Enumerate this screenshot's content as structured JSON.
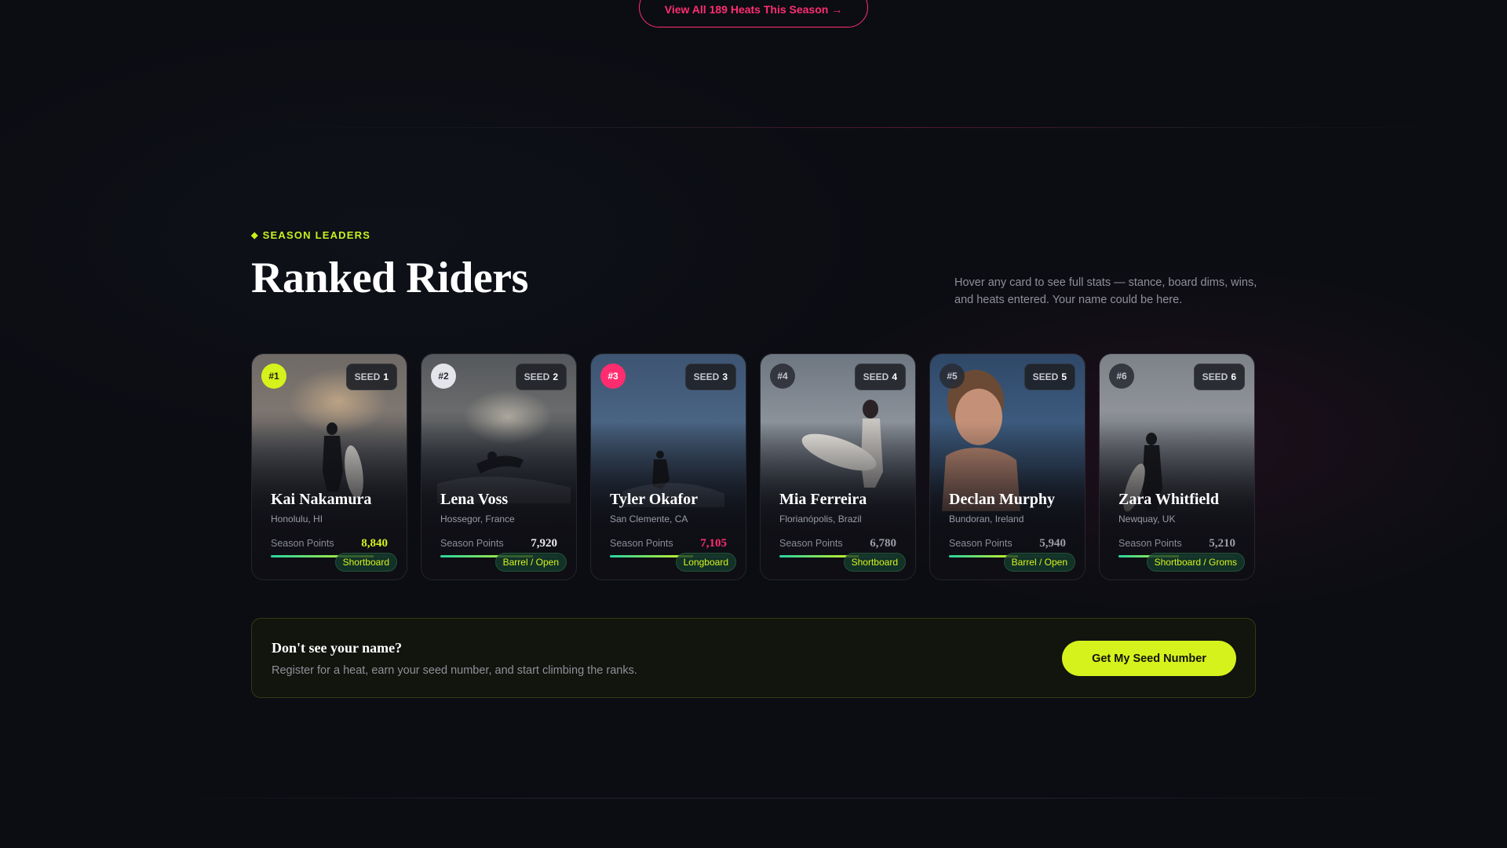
{
  "hero": {
    "view_all_label": "View All 189 Heats This Season →"
  },
  "section": {
    "eyebrow": "SEASON LEADERS",
    "title": "Ranked Riders",
    "subtitle": "Hover any card to see full stats — stance, board dims, wins, and heats entered. Your name could be here."
  },
  "riders": [
    {
      "rank": "#1",
      "seed_label": "SEED",
      "seed": "1",
      "name": "Kai Nakamura",
      "location": "Honolulu, HI",
      "points_label": "Season Points",
      "points": "8,840",
      "progress": 0.88,
      "category": "Shortboard"
    },
    {
      "rank": "#2",
      "seed_label": "SEED",
      "seed": "2",
      "name": "Lena Voss",
      "location": "Hossegor, France",
      "points_label": "Season Points",
      "points": "7,920",
      "progress": 0.79,
      "category": "Barrel / Open"
    },
    {
      "rank": "#3",
      "seed_label": "SEED",
      "seed": "3",
      "name": "Tyler Okafor",
      "location": "San Clemente, CA",
      "points_label": "Season Points",
      "points": "7,105",
      "progress": 0.71,
      "category": "Longboard"
    },
    {
      "rank": "#4",
      "seed_label": "SEED",
      "seed": "4",
      "name": "Mia Ferreira",
      "location": "Florianópolis, Brazil",
      "points_label": "Season Points",
      "points": "6,780",
      "progress": 0.68,
      "category": "Shortboard"
    },
    {
      "rank": "#5",
      "seed_label": "SEED",
      "seed": "5",
      "name": "Declan Murphy",
      "location": "Bundoran, Ireland",
      "points_label": "Season Points",
      "points": "5,940",
      "progress": 0.59,
      "category": "Barrel / Open"
    },
    {
      "rank": "#6",
      "seed_label": "SEED",
      "seed": "6",
      "name": "Zara Whitfield",
      "location": "Newquay, UK",
      "points_label": "Season Points",
      "points": "5,210",
      "progress": 0.52,
      "category": "Shortboard / Groms"
    }
  ],
  "cta": {
    "title": "Don't see your name?",
    "subtitle": "Register for a heat, earn your seed number, and start climbing the ranks.",
    "button_label": "Get My Seed Number"
  },
  "colors": {
    "accent_lime": "#d6f21d",
    "accent_pink": "#ff2d6f",
    "background": "#0c0d13"
  }
}
